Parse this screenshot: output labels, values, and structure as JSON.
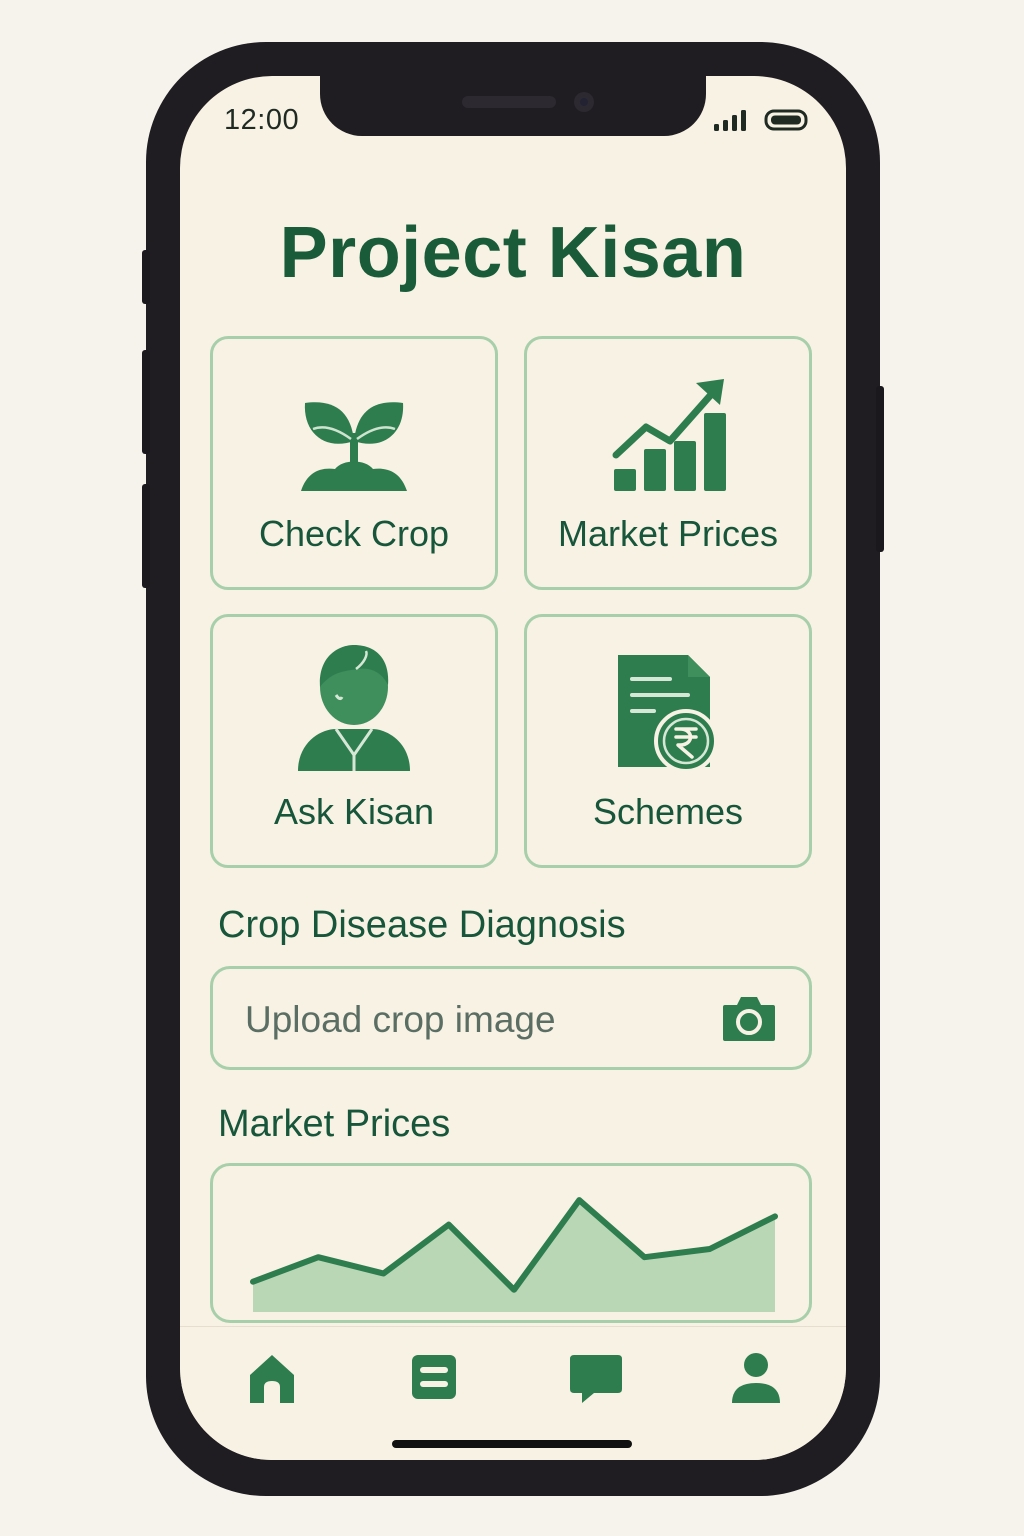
{
  "status_bar": {
    "time": "12:00"
  },
  "app": {
    "title": "Project Kisan"
  },
  "tiles": [
    {
      "label": "Check Crop",
      "icon": "sprout-icon"
    },
    {
      "label": "Market Prices",
      "icon": "bar-chart-trend-icon"
    },
    {
      "label": "Ask Kisan",
      "icon": "farmer-icon"
    },
    {
      "label": "Schemes",
      "icon": "document-rupee-icon"
    }
  ],
  "diagnosis": {
    "title": "Crop Disease Diagnosis",
    "upload_placeholder": "Upload crop image",
    "icon": "camera-icon"
  },
  "market": {
    "title": "Market Prices",
    "chart_data": {
      "type": "area",
      "values": [
        2,
        5,
        3,
        9,
        1,
        12,
        5,
        6,
        10
      ]
    }
  },
  "bottom_nav": [
    {
      "icon": "home-icon"
    },
    {
      "icon": "list-icon"
    },
    {
      "icon": "chat-icon"
    },
    {
      "icon": "profile-icon"
    }
  ],
  "colors": {
    "primary": "#1a5c3a",
    "icon_green": "#2e7d4f",
    "tile_border": "#a7cfaa",
    "background": "#f8f2e4",
    "chart_fill": "#b9d6b5"
  }
}
